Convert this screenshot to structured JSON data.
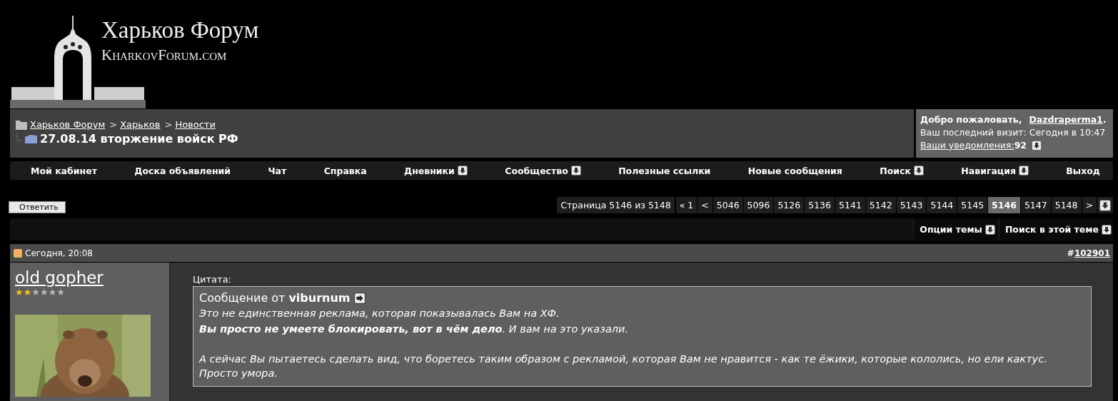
{
  "logo": {
    "title": "Харьков Форум",
    "subtitle": "KharkovForum.com"
  },
  "breadcrumb": {
    "links": [
      "Харьков Форум",
      "Харьков",
      "Новости"
    ],
    "separator": ">",
    "thread_title": "27.08.14 вторжение войск РФ"
  },
  "user_panel": {
    "greeting": "Добро пожаловать,",
    "username": "Dazdraperma1",
    "username_end": ".",
    "last_visit": "Ваш последний визит: Сегодня в 10:47",
    "notifications_label": "Ваши уведомления:",
    "notifications_count": "92"
  },
  "nav": [
    {
      "label": "Мой кабинет",
      "has_menu": false
    },
    {
      "label": "Доска объявлений",
      "has_menu": false
    },
    {
      "label": "Чат",
      "has_menu": false
    },
    {
      "label": "Справка",
      "has_menu": false
    },
    {
      "label": "Дневники",
      "has_menu": true
    },
    {
      "label": "Сообщество",
      "has_menu": true
    },
    {
      "label": "Полезные ссылки",
      "has_menu": false
    },
    {
      "label": "Новые сообщения",
      "has_menu": false
    },
    {
      "label": "Поиск",
      "has_menu": true
    },
    {
      "label": "Навигация",
      "has_menu": true
    },
    {
      "label": "Выход",
      "has_menu": false
    }
  ],
  "reply_button": "Ответить",
  "pagination": {
    "label": "Страница 5146 из 5148",
    "pages": [
      {
        "label": "« 1",
        "selected": false
      },
      {
        "label": "<",
        "selected": false
      },
      {
        "label": "5046",
        "selected": false
      },
      {
        "label": "5096",
        "selected": false
      },
      {
        "label": "5126",
        "selected": false
      },
      {
        "label": "5136",
        "selected": false
      },
      {
        "label": "5141",
        "selected": false
      },
      {
        "label": "5142",
        "selected": false
      },
      {
        "label": "5143",
        "selected": false
      },
      {
        "label": "5144",
        "selected": false
      },
      {
        "label": "5145",
        "selected": false
      },
      {
        "label": "5146",
        "selected": true
      },
      {
        "label": "5147",
        "selected": false
      },
      {
        "label": "5148",
        "selected": false
      },
      {
        "label": ">",
        "selected": false
      }
    ]
  },
  "thread_tools": [
    "Опции темы",
    "Поиск в этой теме"
  ],
  "post": {
    "date": "Сегодня, 20:08",
    "number_prefix": "#",
    "number": "102901",
    "author": "old gopher",
    "stars": 2,
    "quote": {
      "label": "Цитата:",
      "from": "Сообщение от",
      "author": "viburnum",
      "lines": [
        "Это не единственная реклама, которая показывалась Вам на ХФ.",
        "**Вы просто не умеете блокировать, вот в чём дело**. И вам на это указали.",
        "А сейчас Вы пытаетесь сделать вид, что боретесь таким образом с рекламой, которая Вам не нравится - как те ёжики, которые кололись, но ели кактус. Просто умора."
      ]
    }
  }
}
